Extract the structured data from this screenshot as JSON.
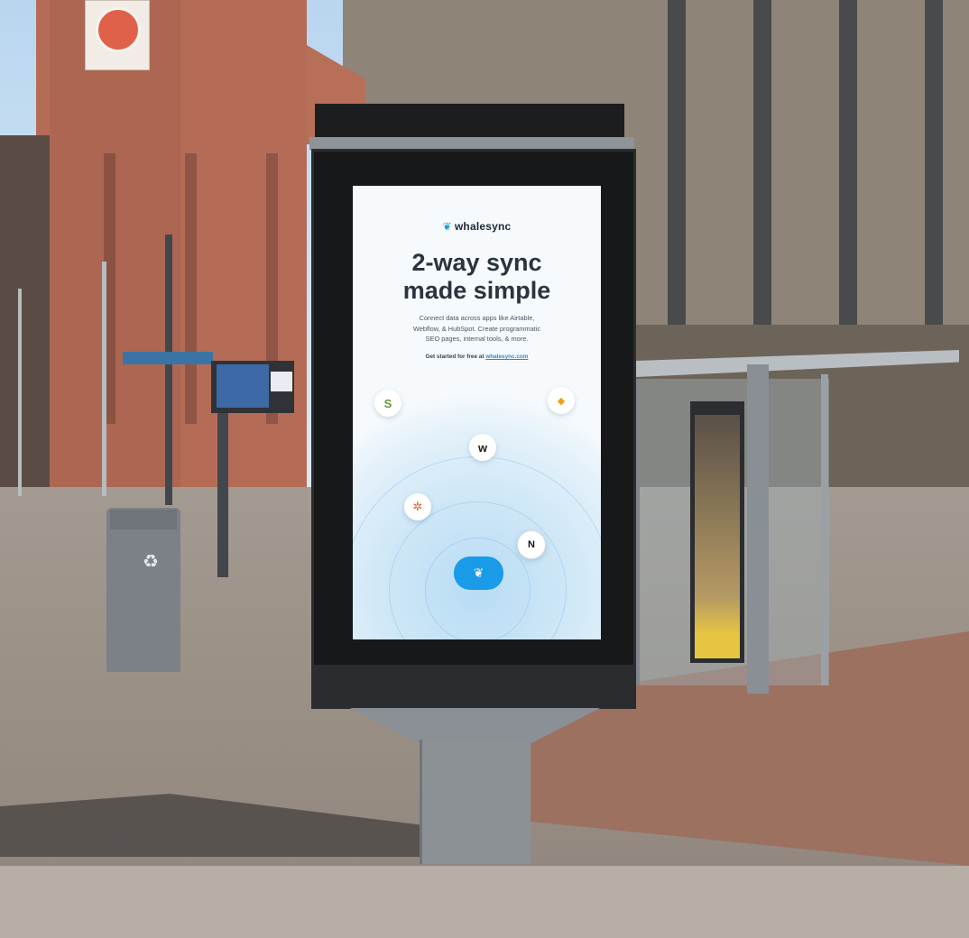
{
  "poster": {
    "brand_name": "whalesync",
    "headline_line1": "2-way sync",
    "headline_line2": "made simple",
    "body_line1": "Connect data across apps like Airtable,",
    "body_line2": "Webflow, & HubSpot. Create programmatic",
    "body_line3": "SEO pages, internal tools, & more.",
    "cta_prefix": "Get started for free at ",
    "cta_link": "whalesync.com",
    "icons": {
      "shopify": "S",
      "airtable": "◆",
      "webflow": "w",
      "hubspot": "✲",
      "notion": "N",
      "center": "❦"
    }
  },
  "colors": {
    "brand_blue": "#1a9be8",
    "headline": "#2b3340"
  }
}
